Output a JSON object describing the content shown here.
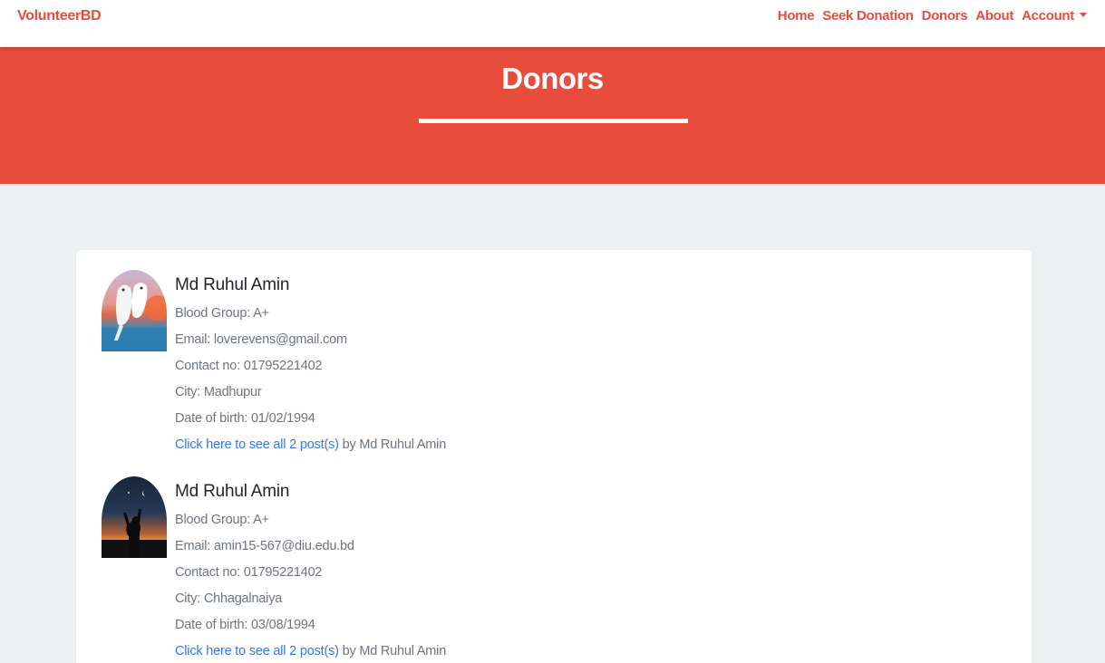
{
  "colors": {
    "brand": "#e74c3c",
    "hero_bg": "#e74c3c",
    "page_bg": "#ecf0f1",
    "link": "#2f7be8"
  },
  "navbar": {
    "brand": "VolunteerBD",
    "links": [
      {
        "label": "Home"
      },
      {
        "label": "Seek Donation"
      },
      {
        "label": "Donors"
      },
      {
        "label": "About"
      },
      {
        "label": "Account",
        "icon": "caret-down-icon"
      }
    ]
  },
  "hero": {
    "title": "Donors"
  },
  "donors": [
    {
      "name": "Md Ruhul Amin",
      "blood_group": "Blood Group: A+",
      "email": "Email: loverevens@gmail.com",
      "contact": "Contact no: 01795221402",
      "city": "City: Madhupur",
      "dob": "Date of birth: 01/02/1994",
      "posts_link": "Click here to see all 2 post(s)",
      "posts_suffix": " by Md Ruhul Amin",
      "avatar": "doves-at-sunset-avatar"
    },
    {
      "name": "Md Ruhul Amin",
      "blood_group": "Blood Group: A+",
      "email": "Email: amin15-567@diu.edu.bd",
      "contact": "Contact no: 01795221402",
      "city": "City: Chhagalnaiya",
      "dob": "Date of birth: 03/08/1994",
      "posts_link": "Click here to see all 2 post(s)",
      "posts_suffix": " by Md Ruhul Amin",
      "avatar": "silhouette-at-dusk-avatar"
    }
  ]
}
